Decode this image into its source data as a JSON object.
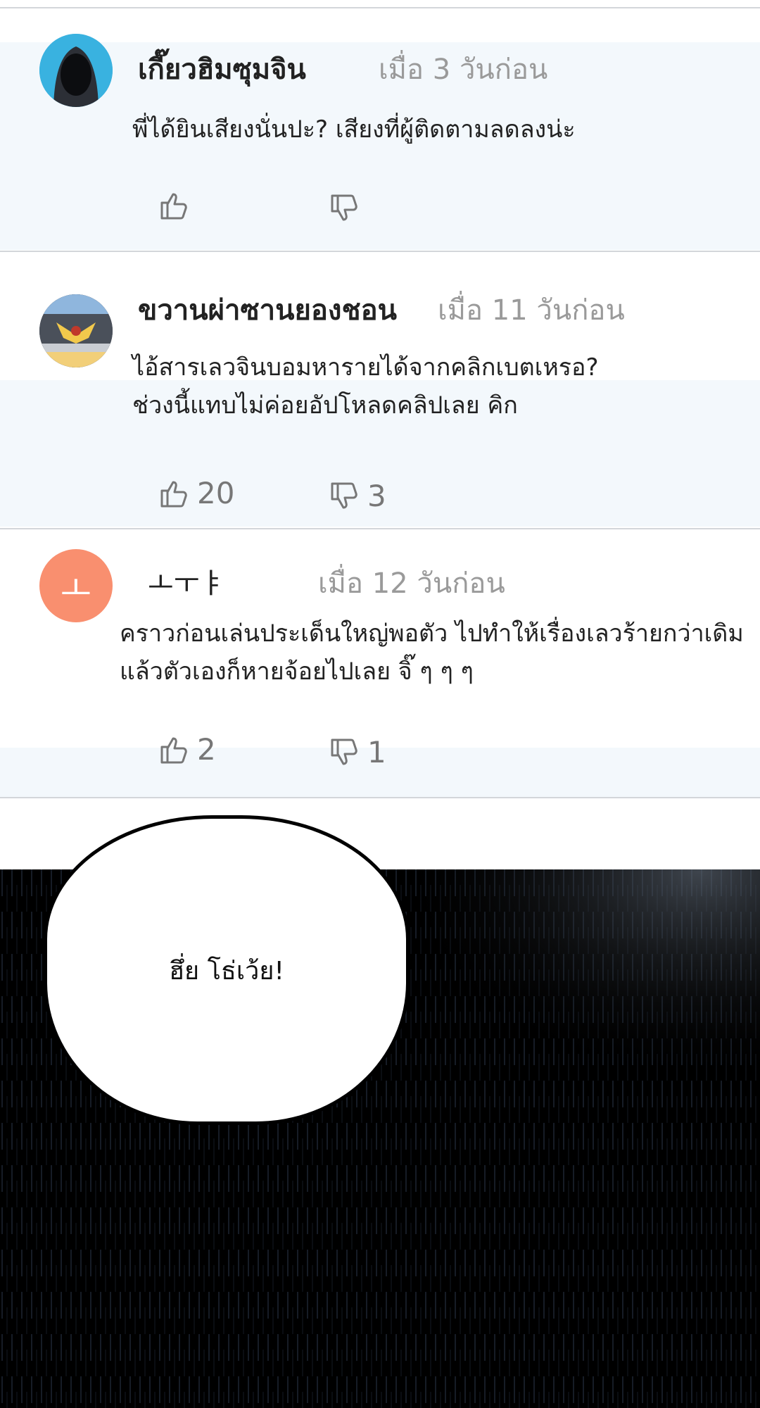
{
  "comments": [
    {
      "name": "เกี๊ยวฮิมซุมจิน",
      "time": "เมื่อ 3 วันก่อน",
      "lines": [
        "พี่ได้ยินเสียงนั่นปะ? เสียงที่ผู้ติดตามลดลงน่ะ"
      ],
      "likes": "",
      "dislikes": ""
    },
    {
      "name": "ขวานผ่าซานยองชอน",
      "time": "เมื่อ 11 วันก่อน",
      "lines": [
        "ไอ้สารเลวจินบอมหารายได้จากคลิกเบตเหรอ?",
        "ช่วงนี้แทบไม่ค่อยอัปโหลดคลิปเลย คิก"
      ],
      "likes": "20",
      "dislikes": "3"
    },
    {
      "name": "ㅗㅜㅑ",
      "time": "เมื่อ 12 วันก่อน",
      "avatar_letter": "ㅗ",
      "lines": [
        "คราวก่อนเล่นประเด็นใหญ่พอตัว ไปทำให้เรื่องเลวร้ายกว่าเดิม",
        "แล้วตัวเองก็หายจ้อยไปเลย จิ๊ ๆ ๆ ๆ"
      ],
      "likes": "2",
      "dislikes": "1"
    }
  ],
  "bubble_text": "ฮึ่ย โธ่เว้ย!",
  "colors": {
    "accent_orange": "#f98f6f",
    "band": "#f3f8fc",
    "muted": "#9a9a9a"
  },
  "icons": [
    "thumbs-up-icon",
    "thumbs-down-icon"
  ]
}
